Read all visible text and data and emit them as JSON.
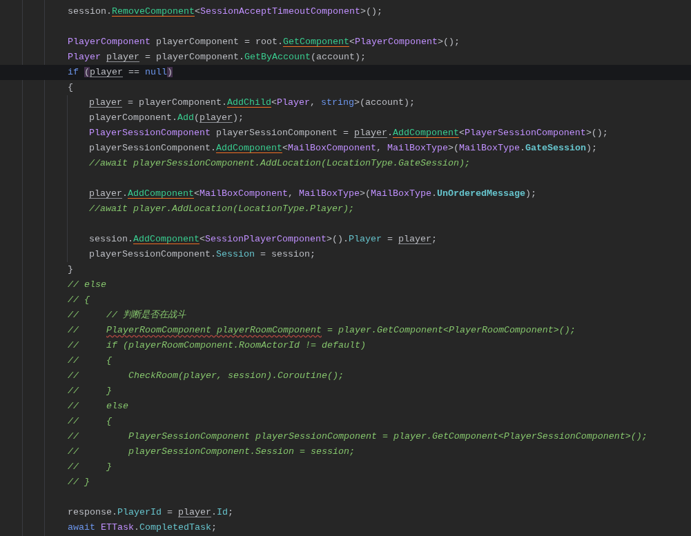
{
  "lines": [
    {
      "current": false,
      "tokens": [
        {
          "text": "session.",
          "kind": "plain",
          "underlined": false,
          "highlight": false
        },
        {
          "text": "RemoveComponent",
          "kind": "method",
          "underlined": true,
          "highlight": false
        },
        {
          "text": "<",
          "kind": "plain",
          "underlined": false,
          "highlight": false
        },
        {
          "text": "SessionAcceptTimeoutComponent",
          "kind": "type",
          "underlined": false,
          "highlight": false
        },
        {
          "text": ">();",
          "kind": "plain",
          "underlined": false,
          "highlight": false
        }
      ]
    },
    {
      "current": false
    },
    {
      "current": false,
      "tokens": [
        {
          "text": "PlayerComponent",
          "kind": "type",
          "underlined": false,
          "highlight": false
        },
        {
          "text": " playerComponent = root.",
          "kind": "plain",
          "underlined": false,
          "highlight": false
        },
        {
          "text": "GetComponent",
          "kind": "method",
          "underlined": true,
          "highlight": false
        },
        {
          "text": "<",
          "kind": "plain",
          "underlined": false,
          "highlight": false
        },
        {
          "text": "PlayerComponent",
          "kind": "type",
          "underlined": false,
          "highlight": false
        },
        {
          "text": ">();",
          "kind": "plain",
          "underlined": false,
          "highlight": false
        }
      ]
    },
    {
      "current": false,
      "tokens": [
        {
          "text": "Player ",
          "kind": "type",
          "underlined": false,
          "highlight": false
        },
        {
          "text": "player",
          "kind": "plain",
          "underlined": true,
          "highlight": false
        },
        {
          "text": " = playerComponent.",
          "kind": "plain",
          "underlined": false,
          "highlight": false
        },
        {
          "text": "GetByAccount",
          "kind": "method",
          "underlined": false,
          "highlight": false
        },
        {
          "text": "(account);",
          "kind": "plain",
          "underlined": false,
          "highlight": false
        }
      ]
    },
    {
      "current": true,
      "tokens": [
        {
          "text": "if ",
          "kind": "keyword",
          "underlined": false,
          "highlight": false
        },
        {
          "text": "(",
          "kind": "plain",
          "underlined": false,
          "highlight": true
        },
        {
          "text": "player",
          "kind": "plain",
          "underlined": true,
          "highlight": false
        },
        {
          "text": " == ",
          "kind": "plain",
          "underlined": false,
          "highlight": false
        },
        {
          "text": "null",
          "kind": "keyword",
          "underlined": false,
          "highlight": false
        },
        {
          "text": ")",
          "kind": "plain",
          "underlined": false,
          "highlight": true
        }
      ]
    },
    {
      "current": false,
      "tokens": [
        {
          "text": "{",
          "kind": "plain",
          "underlined": false,
          "highlight": false
        }
      ],
      "children": [
        {
          "current": false,
          "tokens": [
            {
              "text": "player",
              "kind": "plain",
              "underlined": true,
              "highlight": false
            },
            {
              "text": " = playerComponent.",
              "kind": "plain",
              "underlined": false,
              "highlight": false
            },
            {
              "text": "AddChild",
              "kind": "method",
              "underlined": true,
              "highlight": false
            },
            {
              "text": "<",
              "kind": "plain",
              "underlined": false,
              "highlight": false
            },
            {
              "text": "Player",
              "kind": "type",
              "underlined": false,
              "highlight": false
            },
            {
              "text": ", ",
              "kind": "plain",
              "underlined": false,
              "highlight": false
            },
            {
              "text": "string",
              "kind": "keyword",
              "underlined": false,
              "highlight": false
            },
            {
              "text": ">(account);",
              "kind": "plain",
              "underlined": false,
              "highlight": false
            }
          ]
        },
        {
          "current": false,
          "tokens": [
            {
              "text": "playerComponent.",
              "kind": "plain",
              "underlined": false,
              "highlight": false
            },
            {
              "text": "Add",
              "kind": "method",
              "underlined": false,
              "highlight": false
            },
            {
              "text": "(",
              "kind": "plain",
              "underlined": false,
              "highlight": false
            },
            {
              "text": "player",
              "kind": "plain",
              "underlined": true,
              "highlight": false
            },
            {
              "text": ");",
              "kind": "plain",
              "underlined": false,
              "highlight": false
            }
          ]
        },
        {
          "current": false,
          "tokens": [
            {
              "text": "PlayerSessionComponent",
              "kind": "type",
              "underlined": false,
              "highlight": false
            },
            {
              "text": " playerSessionComponent = ",
              "kind": "plain",
              "underlined": false,
              "highlight": false
            },
            {
              "text": "player",
              "kind": "plain",
              "underlined": true,
              "highlight": false
            },
            {
              "text": ".",
              "kind": "plain",
              "underlined": false,
              "highlight": false
            },
            {
              "text": "AddComponent",
              "kind": "method",
              "underlined": true,
              "highlight": false
            },
            {
              "text": "<",
              "kind": "plain",
              "underlined": false,
              "highlight": false
            },
            {
              "text": "PlayerSessionComponent",
              "kind": "type",
              "underlined": false,
              "highlight": false
            },
            {
              "text": ">();",
              "kind": "plain",
              "underlined": false,
              "highlight": false
            }
          ]
        },
        {
          "current": false,
          "tokens": [
            {
              "text": "playerSessionComponent.",
              "kind": "plain",
              "underlined": false,
              "highlight": false
            },
            {
              "text": "AddComponent",
              "kind": "method",
              "underlined": true,
              "highlight": false
            },
            {
              "text": "<",
              "kind": "plain",
              "underlined": false,
              "highlight": false
            },
            {
              "text": "MailBoxComponent",
              "kind": "type",
              "underlined": false,
              "highlight": false
            },
            {
              "text": ", ",
              "kind": "plain",
              "underlined": false,
              "highlight": false
            },
            {
              "text": "MailBoxType",
              "kind": "type",
              "underlined": false,
              "highlight": false
            },
            {
              "text": ">(",
              "kind": "plain",
              "underlined": false,
              "highlight": false
            },
            {
              "text": "MailBoxType",
              "kind": "type",
              "underlined": false,
              "highlight": false
            },
            {
              "text": ".",
              "kind": "plain",
              "underlined": false,
              "highlight": false
            },
            {
              "text": "GateSession",
              "kind": "enum",
              "underlined": false,
              "highlight": false
            },
            {
              "text": ");",
              "kind": "plain",
              "underlined": false,
              "highlight": false
            }
          ]
        },
        {
          "current": false,
          "tokens": [
            {
              "text": "//await playerSessionComponent.AddLocation(LocationType.GateSession);",
              "kind": "comment",
              "underlined": false,
              "highlight": false
            }
          ]
        },
        {
          "current": false
        },
        {
          "current": false,
          "tokens": [
            {
              "text": "player",
              "kind": "plain",
              "underlined": true,
              "highlight": false
            },
            {
              "text": ".",
              "kind": "plain",
              "underlined": false,
              "highlight": false
            },
            {
              "text": "AddComponent",
              "kind": "method",
              "underlined": true,
              "highlight": false
            },
            {
              "text": "<",
              "kind": "plain",
              "underlined": false,
              "highlight": false
            },
            {
              "text": "MailBoxComponent",
              "kind": "type",
              "underlined": false,
              "highlight": false
            },
            {
              "text": ", ",
              "kind": "plain",
              "underlined": false,
              "highlight": false
            },
            {
              "text": "MailBoxType",
              "kind": "type",
              "underlined": false,
              "highlight": false
            },
            {
              "text": ">(",
              "kind": "plain",
              "underlined": false,
              "highlight": false
            },
            {
              "text": "MailBoxType",
              "kind": "type",
              "underlined": false,
              "highlight": false
            },
            {
              "text": ".",
              "kind": "plain",
              "underlined": false,
              "highlight": false
            },
            {
              "text": "UnOrderedMessage",
              "kind": "enum",
              "underlined": false,
              "highlight": false
            },
            {
              "text": ");",
              "kind": "plain",
              "underlined": false,
              "highlight": false
            }
          ]
        },
        {
          "current": false,
          "tokens": [
            {
              "text": "//await player.AddLocation(LocationType.Player);",
              "kind": "comment",
              "underlined": false,
              "highlight": false
            }
          ]
        },
        {
          "current": false
        },
        {
          "current": false,
          "tokens": [
            {
              "text": "session.",
              "kind": "plain",
              "underlined": false,
              "highlight": false
            },
            {
              "text": "AddComponent",
              "kind": "method",
              "underlined": true,
              "highlight": false
            },
            {
              "text": "<",
              "kind": "plain",
              "underlined": false,
              "highlight": false
            },
            {
              "text": "SessionPlayerComponent",
              "kind": "type",
              "underlined": false,
              "highlight": false
            },
            {
              "text": ">().",
              "kind": "plain",
              "underlined": false,
              "highlight": false
            },
            {
              "text": "Player",
              "kind": "property",
              "underlined": false,
              "highlight": false
            },
            {
              "text": " = ",
              "kind": "plain",
              "underlined": false,
              "highlight": false
            },
            {
              "text": "player",
              "kind": "plain",
              "underlined": true,
              "highlight": false
            },
            {
              "text": ";",
              "kind": "plain",
              "underlined": false,
              "highlight": false
            }
          ]
        },
        {
          "current": false,
          "tokens": [
            {
              "text": "playerSessionComponent.",
              "kind": "plain",
              "underlined": false,
              "highlight": false
            },
            {
              "text": "Session",
              "kind": "property",
              "underlined": false,
              "highlight": false
            },
            {
              "text": " = session;",
              "kind": "plain",
              "underlined": false,
              "highlight": false
            }
          ]
        }
      ]
    },
    {
      "current": false,
      "tokens": [
        {
          "text": "}",
          "kind": "plain",
          "underlined": false,
          "highlight": false
        }
      ]
    },
    {
      "current": false,
      "tokens": [
        {
          "text": "// else",
          "kind": "comment",
          "underlined": false,
          "highlight": false
        }
      ]
    },
    {
      "current": false,
      "tokens": [
        {
          "text": "// {",
          "kind": "comment",
          "underlined": false,
          "highlight": false
        }
      ]
    },
    {
      "current": false,
      "tokens": [
        {
          "text": "//     // 判断是否在战斗",
          "kind": "comment",
          "underlined": false,
          "highlight": false
        }
      ]
    },
    {
      "current": false,
      "tokens": [
        {
          "text": "//     ",
          "kind": "comment",
          "underlined": false,
          "highlight": false
        },
        {
          "text": "PlayerRoomComponent playerRoomComponent",
          "kind": "comment",
          "underlined": true,
          "highlight": false
        },
        {
          "text": " = player.GetComponent<PlayerRoomComponent>();",
          "kind": "comment",
          "underlined": false,
          "highlight": false
        }
      ]
    },
    {
      "current": false,
      "tokens": [
        {
          "text": "//     if (playerRoomComponent.RoomActorId != default)",
          "kind": "comment",
          "underlined": false,
          "highlight": false
        }
      ]
    },
    {
      "current": false,
      "tokens": [
        {
          "text": "//     {",
          "kind": "comment",
          "underlined": false,
          "highlight": false
        }
      ]
    },
    {
      "current": false,
      "tokens": [
        {
          "text": "//         CheckRoom(player, session).Coroutine();",
          "kind": "comment",
          "underlined": false,
          "highlight": false
        }
      ]
    },
    {
      "current": false,
      "tokens": [
        {
          "text": "//     }",
          "kind": "comment",
          "underlined": false,
          "highlight": false
        }
      ]
    },
    {
      "current": false,
      "tokens": [
        {
          "text": "//     else",
          "kind": "comment",
          "underlined": false,
          "highlight": false
        }
      ]
    },
    {
      "current": false,
      "tokens": [
        {
          "text": "//     {",
          "kind": "comment",
          "underlined": false,
          "highlight": false
        }
      ]
    },
    {
      "current": false,
      "tokens": [
        {
          "text": "//         PlayerSessionComponent playerSessionComponent = player.GetComponent<PlayerSessionComponent>();",
          "kind": "comment",
          "underlined": false,
          "highlight": false
        }
      ]
    },
    {
      "current": false,
      "tokens": [
        {
          "text": "//         playerSessionComponent.Session = session;",
          "kind": "comment",
          "underlined": false,
          "highlight": false
        }
      ]
    },
    {
      "current": false,
      "tokens": [
        {
          "text": "//     }",
          "kind": "comment",
          "underlined": false,
          "highlight": false
        }
      ]
    },
    {
      "current": false,
      "tokens": [
        {
          "text": "// }",
          "kind": "comment",
          "underlined": false,
          "highlight": false
        }
      ]
    },
    {
      "current": false
    },
    {
      "current": false,
      "tokens": [
        {
          "text": "response.",
          "kind": "plain",
          "underlined": false,
          "highlight": false
        },
        {
          "text": "PlayerId",
          "kind": "property",
          "underlined": false,
          "highlight": false
        },
        {
          "text": " = ",
          "kind": "plain",
          "underlined": false,
          "highlight": false
        },
        {
          "text": "player",
          "kind": "plain",
          "underlined": true,
          "highlight": false
        },
        {
          "text": ".",
          "kind": "plain",
          "underlined": false,
          "highlight": false
        },
        {
          "text": "Id",
          "kind": "property",
          "underlined": false,
          "highlight": false
        },
        {
          "text": ";",
          "kind": "plain",
          "underlined": false,
          "highlight": false
        }
      ]
    },
    {
      "current": false,
      "tokens": [
        {
          "text": "await ",
          "kind": "keyword",
          "underlined": false,
          "highlight": false
        },
        {
          "text": "ETTask",
          "kind": "type",
          "underlined": false,
          "highlight": false
        },
        {
          "text": ".",
          "kind": "plain",
          "underlined": false,
          "highlight": false
        },
        {
          "text": "CompletedTask",
          "kind": "property",
          "underlined": false,
          "highlight": false
        },
        {
          "text": ";",
          "kind": "plain",
          "underlined": false,
          "highlight": false
        }
      ]
    }
  ]
}
